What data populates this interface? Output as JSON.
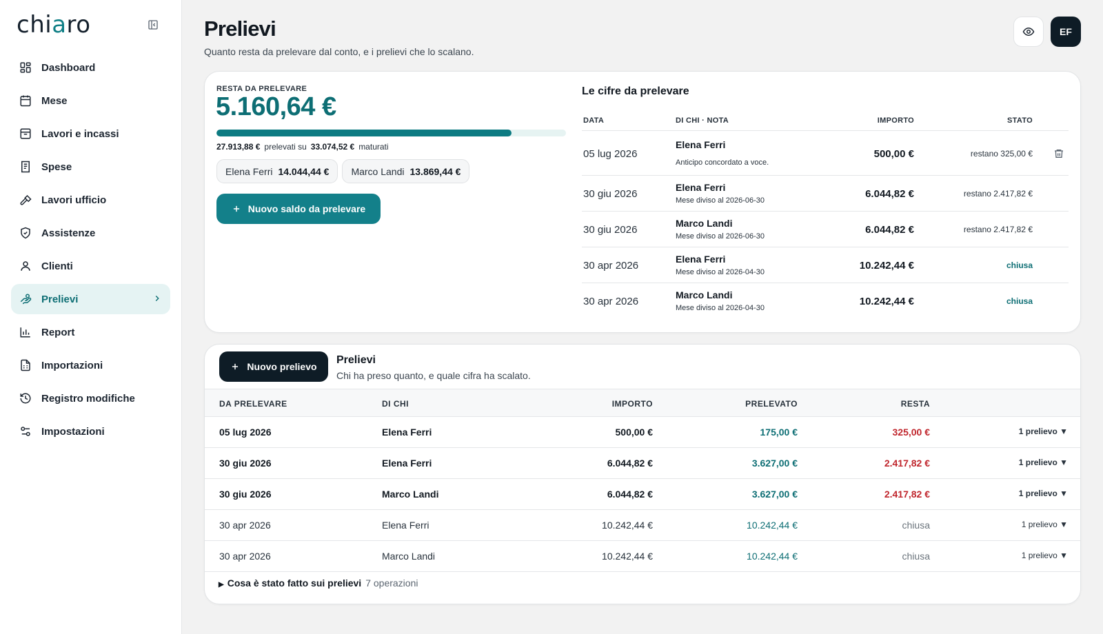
{
  "app": {
    "logo_main": "chi",
    "logo_accent": "a",
    "logo_end": "ro"
  },
  "sidebar": {
    "items": [
      {
        "label": "Dashboard",
        "icon": "grid-icon"
      },
      {
        "label": "Mese",
        "icon": "calendar-icon"
      },
      {
        "label": "Lavori e incassi",
        "icon": "inbox-icon"
      },
      {
        "label": "Spese",
        "icon": "receipt-icon"
      },
      {
        "label": "Lavori ufficio",
        "icon": "hammer-icon"
      },
      {
        "label": "Assistenze",
        "icon": "shield-icon"
      },
      {
        "label": "Clienti",
        "icon": "user-icon"
      },
      {
        "label": "Prelievi",
        "icon": "hand-coins-icon",
        "active": true
      },
      {
        "label": "Report",
        "icon": "bar-chart-icon"
      },
      {
        "label": "Importazioni",
        "icon": "file-spreadsheet-icon"
      },
      {
        "label": "Registro modifiche",
        "icon": "history-icon"
      },
      {
        "label": "Impostazioni",
        "icon": "sliders-icon"
      }
    ]
  },
  "header": {
    "title": "Prelievi",
    "subtitle": "Quanto resta da prelevare dal conto, e i prelievi che lo scalano.",
    "avatar_initials": "EF"
  },
  "summary": {
    "kicker": "RESTA DA PRELEVARE",
    "amount": "5.160,64 €",
    "progress_fraction": 0.844,
    "withdrawn": "27.913,88 €",
    "withdrawn_label": "prelevati su",
    "accrued": "33.074,52 €",
    "accrued_label": "maturati",
    "chips": [
      {
        "name": "Elena Ferri",
        "value": "14.044,44 €"
      },
      {
        "name": "Marco Landi",
        "value": "13.869,44 €"
      }
    ],
    "new_balance_button": "Nuovo saldo da prelevare"
  },
  "cifre": {
    "title": "Le cifre da prelevare",
    "headers": {
      "date": "DATA",
      "who": "DI CHI · NOTA",
      "amount": "IMPORTO",
      "status": "STATO"
    },
    "rows": [
      {
        "date": "05 lug 2026",
        "name": "Elena Ferri",
        "note": "Anticipo concordato a voce.",
        "amount": "500,00 €",
        "status": "restano 325,00 €",
        "closed": false,
        "trash": true
      },
      {
        "date": "30 giu 2026",
        "name": "Elena Ferri",
        "note": "Mese diviso al 2026-06-30",
        "amount": "6.044,82 €",
        "status": "restano 2.417,82 €",
        "closed": false
      },
      {
        "date": "30 giu 2026",
        "name": "Marco Landi",
        "note": "Mese diviso al 2026-06-30",
        "amount": "6.044,82 €",
        "status": "restano 2.417,82 €",
        "closed": false
      },
      {
        "date": "30 apr 2026",
        "name": "Elena Ferri",
        "note": "Mese diviso al 2026-04-30",
        "amount": "10.242,44 €",
        "status": "chiusa",
        "closed": true
      },
      {
        "date": "30 apr 2026",
        "name": "Marco Landi",
        "note": "Mese diviso al 2026-04-30",
        "amount": "10.242,44 €",
        "status": "chiusa",
        "closed": true
      }
    ]
  },
  "prelievi": {
    "new_button": "Nuovo prelievo",
    "title": "Prelievi",
    "subtitle": "Chi ha preso quanto, e quale cifra ha scalato.",
    "headers": {
      "date": "DA PRELEVARE",
      "who": "DI CHI",
      "amount": "IMPORTO",
      "withdrawn": "PRELEVATO",
      "remaining": "RESTA"
    },
    "rows": [
      {
        "date": "05 lug 2026",
        "who": "Elena Ferri",
        "amount": "500,00 €",
        "withdrawn": "175,00 €",
        "remaining": "325,00 €",
        "count": "1 prelievo ▼",
        "open": true
      },
      {
        "date": "30 giu 2026",
        "who": "Elena Ferri",
        "amount": "6.044,82 €",
        "withdrawn": "3.627,00 €",
        "remaining": "2.417,82 €",
        "count": "1 prelievo ▼",
        "open": true
      },
      {
        "date": "30 giu 2026",
        "who": "Marco Landi",
        "amount": "6.044,82 €",
        "withdrawn": "3.627,00 €",
        "remaining": "2.417,82 €",
        "count": "1 prelievo ▼",
        "open": true
      },
      {
        "date": "30 apr 2026",
        "who": "Elena Ferri",
        "amount": "10.242,44 €",
        "withdrawn": "10.242,44 €",
        "remaining": "chiusa",
        "count": "1 prelievo ▼",
        "open": false
      },
      {
        "date": "30 apr 2026",
        "who": "Marco Landi",
        "amount": "10.242,44 €",
        "withdrawn": "10.242,44 €",
        "remaining": "chiusa",
        "count": "1 prelievo ▼",
        "open": false
      }
    ],
    "history_label": "Cosa è stato fatto sui prelievi",
    "history_count": "7 operazioni"
  },
  "colors": {
    "accent": "#0d6e74",
    "dark": "#0e1c26",
    "danger": "#c0262d"
  }
}
